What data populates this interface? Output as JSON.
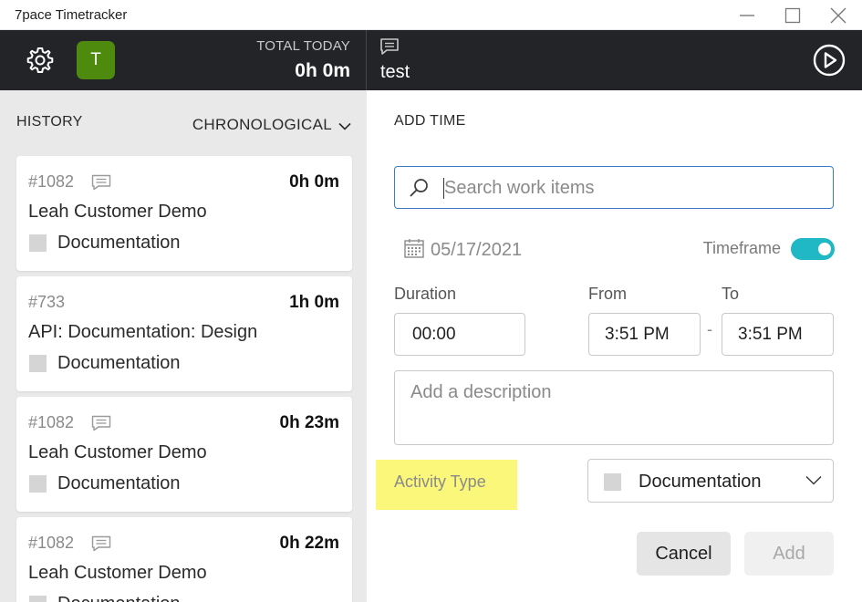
{
  "window": {
    "title": "7pace Timetracker"
  },
  "header": {
    "avatar_initial": "T",
    "total_today_label": "TOTAL TODAY",
    "total_today_value": "0h 0m",
    "current_work_item": "test"
  },
  "history": {
    "label": "HISTORY",
    "sort_label": "CHRONOLOGICAL",
    "items": [
      {
        "id": "#1082",
        "duration": "0h 0m",
        "title": "Leah Customer Demo",
        "activity": "Documentation",
        "has_comment": true
      },
      {
        "id": "#733",
        "duration": "1h 0m",
        "title": "API: Documentation: Design",
        "activity": "Documentation",
        "has_comment": false
      },
      {
        "id": "#1082",
        "duration": "0h 23m",
        "title": "Leah Customer Demo",
        "activity": "Documentation",
        "has_comment": true
      },
      {
        "id": "#1082",
        "duration": "0h 22m",
        "title": "Leah Customer Demo",
        "activity": "Documentation",
        "has_comment": true
      }
    ]
  },
  "add_time": {
    "heading": "ADD TIME",
    "search_placeholder": "Search work items",
    "date": "05/17/2021",
    "timeframe_label": "Timeframe",
    "timeframe_on": true,
    "duration_label": "Duration",
    "duration_value": "00:00",
    "from_label": "From",
    "from_value": "3:51 PM",
    "to_label": "To",
    "to_value": "3:51 PM",
    "separator": "-",
    "description_placeholder": "Add a description",
    "activity_type_label": "Activity Type",
    "activity_type_value": "Documentation",
    "cancel_label": "Cancel",
    "add_label": "Add"
  },
  "colors": {
    "header_bg": "#232428",
    "avatar_bg": "#4e8a0d",
    "toggle_on": "#1fb8c4",
    "search_border": "#3b7bc4",
    "highlight": "#fbf77a",
    "left_panel_bg": "#e9e9e9"
  },
  "icons": [
    "gear-icon",
    "comment-icon",
    "play-icon",
    "chevron-down-icon",
    "search-icon",
    "calendar-icon",
    "minimize-icon",
    "maximize-icon",
    "close-icon"
  ]
}
